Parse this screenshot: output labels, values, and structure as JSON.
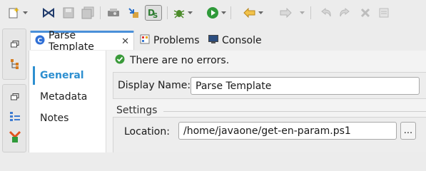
{
  "toolbar": {
    "icons": [
      "new-wizard-icon",
      "bowtie-icon",
      "save-icon",
      "save-all-icon",
      "print-icon",
      "import-icon",
      "ds-perspective-icon",
      "debug-icon",
      "run-icon",
      "back-icon",
      "forward-icon",
      "undo-icon",
      "redo-icon",
      "delete-icon",
      "task-icon"
    ]
  },
  "trim": {
    "icons": [
      "restore-icon",
      "hierarchy-icon",
      "restore-icon",
      "outline-icon",
      "components-icon"
    ]
  },
  "tabs": [
    {
      "label": "Parse Template",
      "icon": "template-icon",
      "active": true,
      "closable": true
    },
    {
      "label": "Problems",
      "icon": "problems-icon",
      "active": false
    },
    {
      "label": "Console",
      "icon": "console-icon",
      "active": false
    }
  ],
  "tab_close_glyph": "✕",
  "nav": {
    "items": [
      {
        "label": "General",
        "selected": true
      },
      {
        "label": "Metadata",
        "selected": false
      },
      {
        "label": "Notes",
        "selected": false
      }
    ]
  },
  "status": {
    "message": "There are no errors.",
    "icon": "check-icon",
    "color": "#3a9a3a"
  },
  "general": {
    "display_name_label": "Display Name:",
    "display_name_value": "Parse Template",
    "settings_title": "Settings",
    "location_label": "Location:",
    "location_value": "/home/javaone/get-en-param.ps1",
    "browse_label": "..."
  },
  "colors": {
    "accent": "#2d8fd0",
    "tab_highlight": "#4a90d9"
  }
}
